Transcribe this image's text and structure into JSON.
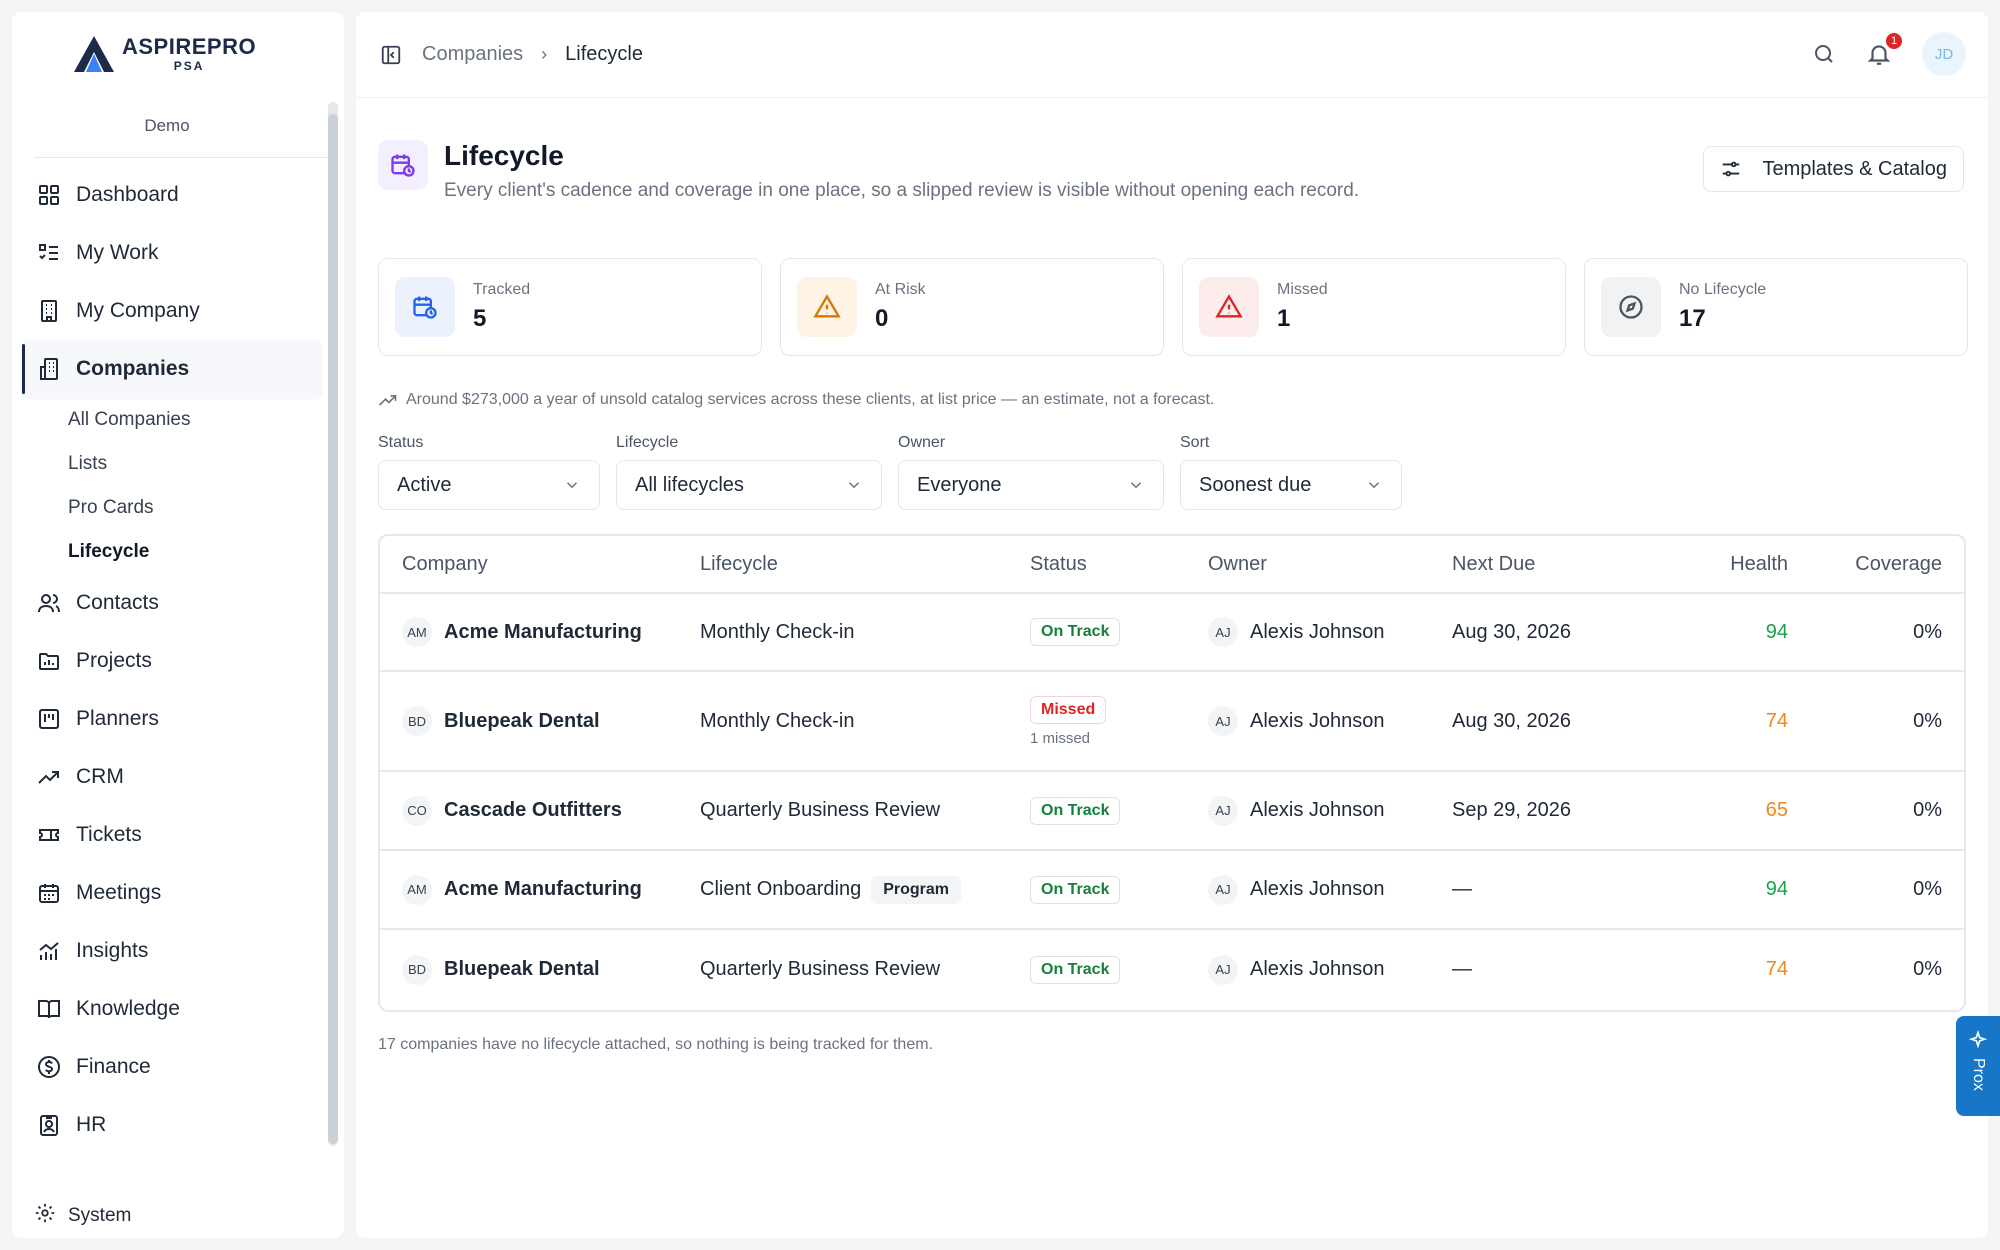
{
  "sidebar": {
    "logo_main": "ASPIREPRO",
    "logo_sub": "PSA",
    "workspace": "Demo",
    "items": [
      {
        "label": "Dashboard",
        "icon": "grid-icon"
      },
      {
        "label": "My Work",
        "icon": "checklist-icon"
      },
      {
        "label": "My Company",
        "icon": "building-icon"
      },
      {
        "label": "Companies",
        "icon": "office-icon",
        "active": true
      },
      {
        "label": "Contacts",
        "icon": "users-icon"
      },
      {
        "label": "Projects",
        "icon": "folder-icon"
      },
      {
        "label": "Planners",
        "icon": "board-icon"
      },
      {
        "label": "CRM",
        "icon": "trend-icon"
      },
      {
        "label": "Tickets",
        "icon": "ticket-icon"
      },
      {
        "label": "Meetings",
        "icon": "calendar-icon"
      },
      {
        "label": "Insights",
        "icon": "chart-icon"
      },
      {
        "label": "Knowledge",
        "icon": "book-icon"
      },
      {
        "label": "Finance",
        "icon": "dollar-icon"
      },
      {
        "label": "HR",
        "icon": "id-badge-icon"
      }
    ],
    "sub_items": [
      "All Companies",
      "Lists",
      "Pro Cards",
      "Lifecycle"
    ],
    "system_label": "System"
  },
  "topbar": {
    "breadcrumb": [
      "Companies",
      "Lifecycle"
    ],
    "notification_count": "1",
    "user_initials": "JD"
  },
  "header": {
    "title": "Lifecycle",
    "description": "Every client's cadence and coverage in one place, so a slipped review is visible without opening each record.",
    "templates_button": "Templates & Catalog"
  },
  "stats": [
    {
      "label": "Tracked",
      "value": "5",
      "icon": "calendar-clock-icon",
      "color": "#2563eb"
    },
    {
      "label": "At Risk",
      "value": "0",
      "icon": "warning-icon",
      "color": "#d97706"
    },
    {
      "label": "Missed",
      "value": "1",
      "icon": "alert-icon",
      "color": "#dc2626"
    },
    {
      "label": "No Lifecycle",
      "value": "17",
      "icon": "compass-icon",
      "color": "#4b5563"
    }
  ],
  "estimate_note": "Around $273,000 a year of unsold catalog services across these clients, at list price — an estimate, not a forecast.",
  "filters": {
    "status": {
      "label": "Status",
      "value": "Active"
    },
    "lifecycle": {
      "label": "Lifecycle",
      "value": "All lifecycles"
    },
    "owner": {
      "label": "Owner",
      "value": "Everyone"
    },
    "sort": {
      "label": "Sort",
      "value": "Soonest due"
    }
  },
  "table": {
    "headers": {
      "company": "Company",
      "lifecycle": "Lifecycle",
      "status": "Status",
      "owner": "Owner",
      "next_due": "Next Due",
      "health": "Health",
      "coverage": "Coverage"
    },
    "rows": [
      {
        "initials": "AM",
        "company": "Acme Manufacturing",
        "lifecycle": "Monthly Check-in",
        "tag": "",
        "status": "On Track",
        "status_sub": "",
        "owner_initials": "AJ",
        "owner": "Alexis Johnson",
        "next_due": "Aug 30, 2026",
        "health": "94",
        "coverage": "0%"
      },
      {
        "initials": "BD",
        "company": "Bluepeak Dental",
        "lifecycle": "Monthly Check-in",
        "tag": "",
        "status": "Missed",
        "status_sub": "1 missed",
        "owner_initials": "AJ",
        "owner": "Alexis Johnson",
        "next_due": "Aug 30, 2026",
        "health": "74",
        "coverage": "0%"
      },
      {
        "initials": "CO",
        "company": "Cascade Outfitters",
        "lifecycle": "Quarterly Business Review",
        "tag": "",
        "status": "On Track",
        "status_sub": "",
        "owner_initials": "AJ",
        "owner": "Alexis Johnson",
        "next_due": "Sep 29, 2026",
        "health": "65",
        "coverage": "0%"
      },
      {
        "initials": "AM",
        "company": "Acme Manufacturing",
        "lifecycle": "Client Onboarding",
        "tag": "Program",
        "status": "On Track",
        "status_sub": "",
        "owner_initials": "AJ",
        "owner": "Alexis Johnson",
        "next_due": "—",
        "health": "94",
        "coverage": "0%"
      },
      {
        "initials": "BD",
        "company": "Bluepeak Dental",
        "lifecycle": "Quarterly Business Review",
        "tag": "",
        "status": "On Track",
        "status_sub": "",
        "owner_initials": "AJ",
        "owner": "Alexis Johnson",
        "next_due": "—",
        "health": "74",
        "coverage": "0%"
      }
    ]
  },
  "footer_note": "17 companies have no lifecycle attached, so nothing is being tracked for them.",
  "prox_label": "Prox",
  "colors": {
    "health_green": "#16a34a",
    "health_orange": "#ea8a1c",
    "accent": "#1677c9"
  }
}
